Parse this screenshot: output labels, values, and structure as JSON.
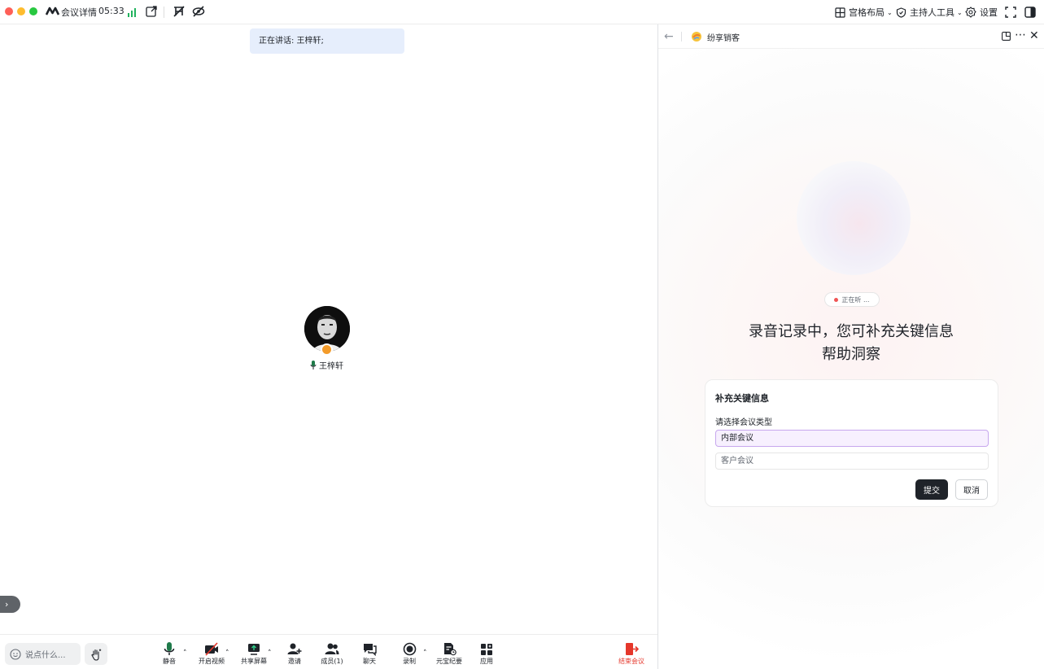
{
  "titlebar": {
    "meeting_detail": "会议详情",
    "time": "05:33",
    "grid_layout": "宫格布局",
    "host_tools": "主持人工具",
    "settings": "设置"
  },
  "stage": {
    "speaking_text": "正在讲话: 王梓轩;",
    "participant_name": "王梓轩"
  },
  "toolbar": {
    "say_placeholder": "说点什么...",
    "mute": "静音",
    "start_video": "开启视频",
    "share_screen": "共享屏幕",
    "invite": "邀请",
    "members": "成员(1)",
    "chat": "聊天",
    "record": "录制",
    "yuanbao_notes": "元宝纪要",
    "apps": "应用",
    "end_meeting": "结束会议"
  },
  "panel": {
    "title": "纷享销客",
    "listening": "正在听 ...",
    "headline_line1": "录音记录中，您可补充关键信息",
    "headline_line2": "帮助洞察",
    "card": {
      "title": "补充关键信息",
      "label": "请选择会议类型",
      "options": [
        "内部会议",
        "客户会议"
      ],
      "submit": "提交",
      "cancel": "取消"
    }
  },
  "colors": {
    "accent": "#1f2329",
    "end_red": "#e5372b",
    "signal_green": "#22b35e",
    "selected_bg": "#f7f0fe"
  }
}
